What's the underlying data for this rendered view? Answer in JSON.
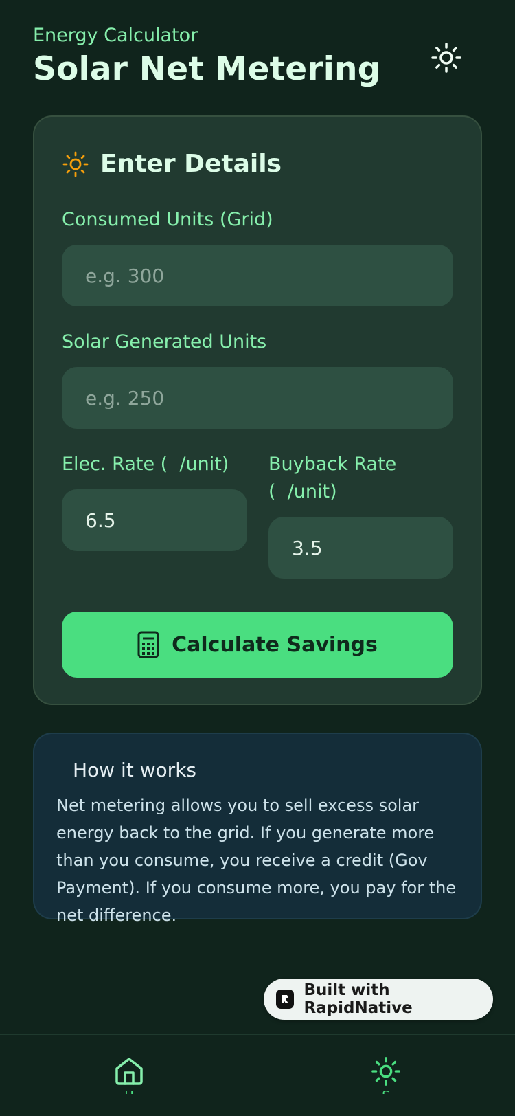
{
  "header": {
    "subtitle": "Energy Calculator",
    "title": "Solar Net Metering",
    "theme_icon": "sun-icon"
  },
  "card": {
    "title": "Enter Details",
    "title_icon": "sun-icon",
    "consumed": {
      "label": "Consumed Units (Grid)",
      "placeholder": "e.g. 300"
    },
    "solar": {
      "label": "Solar Generated Units",
      "placeholder": "e.g. 250"
    },
    "elec_rate": {
      "label": "Elec. Rate (  /unit)",
      "value": "6.5"
    },
    "buyback_rate": {
      "label_line1": "Buyback Rate",
      "label_line2": "(  /unit)",
      "value": "3.5"
    },
    "button": {
      "label": "Calculate Savings",
      "icon": "calculator-icon"
    }
  },
  "info": {
    "title": "How it works",
    "text": "Net metering allows you to sell excess solar energy back to the grid. If you generate more than you consume, you receive a credit (Gov Payment). If you consume more, you pay for the net difference."
  },
  "badge": {
    "label": "Built with RapidNative"
  },
  "tabs": [
    {
      "icon": "home-icon",
      "label": "H"
    },
    {
      "icon": "sun-icon",
      "label": "S"
    }
  ],
  "colors": {
    "background": "#10241c",
    "card": "#213a30",
    "accent": "#4ade80",
    "label": "#86efac",
    "orange": "#f59e0b"
  }
}
